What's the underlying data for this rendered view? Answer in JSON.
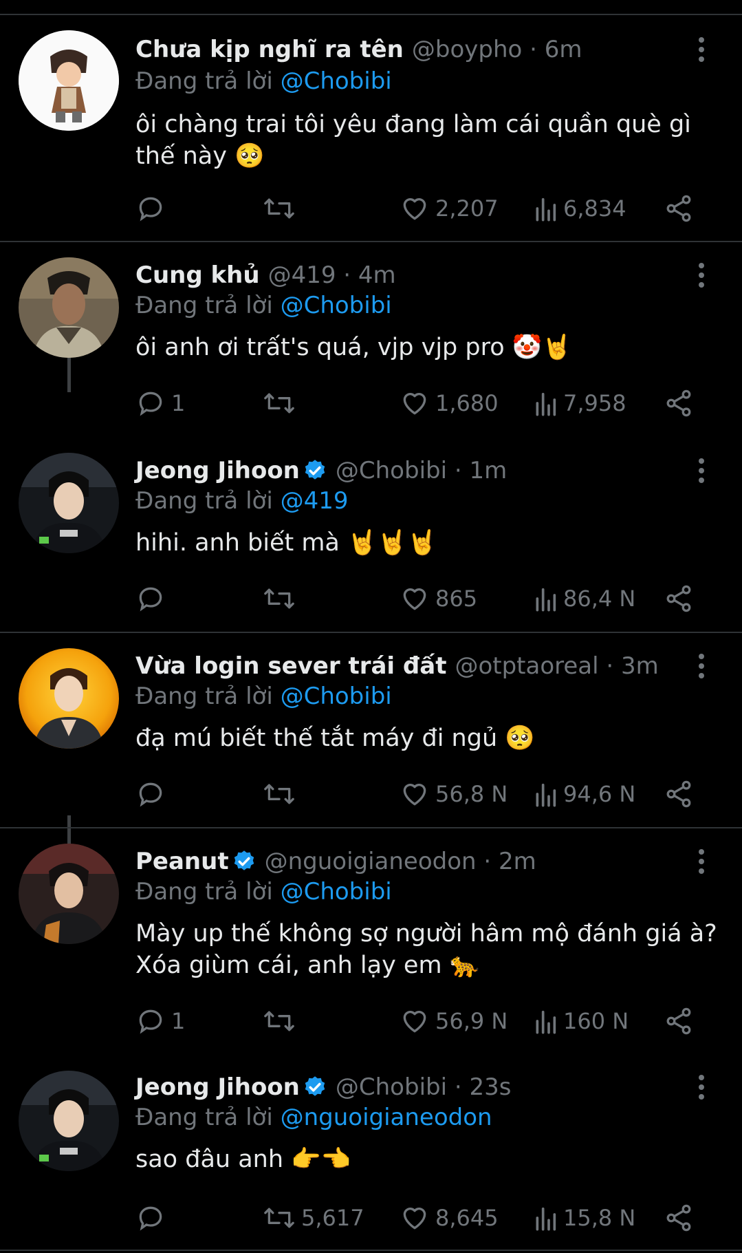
{
  "reply_prefix": "Đang trả lời",
  "colors": {
    "background": "#000000",
    "text": "#e7e9ea",
    "muted": "#71767b",
    "link": "#1d9bf0",
    "separator": "#2f3336"
  },
  "icons": [
    "more-vertical-icon",
    "reply-icon",
    "retweet-icon",
    "like-icon",
    "views-icon",
    "share-icon",
    "verified-badge-icon"
  ],
  "tweets": [
    {
      "name": "Chưa kịp nghĩ ra tên",
      "handle": "@boypho",
      "time": "6m",
      "meta": "@boypho · 6m",
      "verified": false,
      "reply_to": "@Chobibi",
      "lines": [
        "ôi chàng trai tôi yêu đang làm cái quần què gì",
        "thế này 🥺"
      ],
      "replies": "",
      "retweets": "",
      "likes": "2,207",
      "views": "6,834"
    },
    {
      "name": "Cung khủ",
      "handle": "@419",
      "time": "4m",
      "meta": "@419 · 4m",
      "verified": false,
      "reply_to": "@Chobibi",
      "lines": [
        "ôi anh ơi trất's quá, vjp vjp pro 🤡🤘"
      ],
      "replies": "1",
      "retweets": "",
      "likes": "1,680",
      "views": "7,958"
    },
    {
      "name": "Jeong Jihoon",
      "handle": "@Chobibi",
      "time": "1m",
      "meta": "@Chobibi · 1m",
      "verified": true,
      "reply_to": "@419",
      "lines": [
        "hihi. anh biết mà 🤘🤘🤘"
      ],
      "replies": "",
      "retweets": "",
      "likes": "865",
      "views": "86,4 N"
    },
    {
      "name": "Vừa login sever trái đất",
      "handle": "@otptaoreal",
      "time": "3m",
      "meta": "@otptaoreal · 3m",
      "verified": false,
      "reply_to": "@Chobibi",
      "lines": [
        "đạ mú biết thế tắt máy đi ngủ 🥺"
      ],
      "replies": "",
      "retweets": "",
      "likes": "56,8 N",
      "views": "94,6 N"
    },
    {
      "name": "Peanut",
      "handle": "@nguoigianeodon",
      "time": "2m",
      "meta": "@nguoigianeodon · 2m",
      "verified": true,
      "reply_to": "@Chobibi",
      "lines": [
        "Mày up thế không sợ người hâm mộ đánh giá à?",
        "Xóa giùm cái, anh lạy em 🐆"
      ],
      "replies": "1",
      "retweets": "",
      "likes": "56,9 N",
      "views": "160 N"
    },
    {
      "name": "Jeong Jihoon",
      "handle": "@Chobibi",
      "time": "23s",
      "meta": "@Chobibi · 23s",
      "verified": true,
      "reply_to": "@nguoigianeodon",
      "lines": [
        "sao đâu anh 👉👈"
      ],
      "replies": "",
      "retweets": "5,617",
      "likes": "8,645",
      "views": "15,8 N"
    }
  ]
}
